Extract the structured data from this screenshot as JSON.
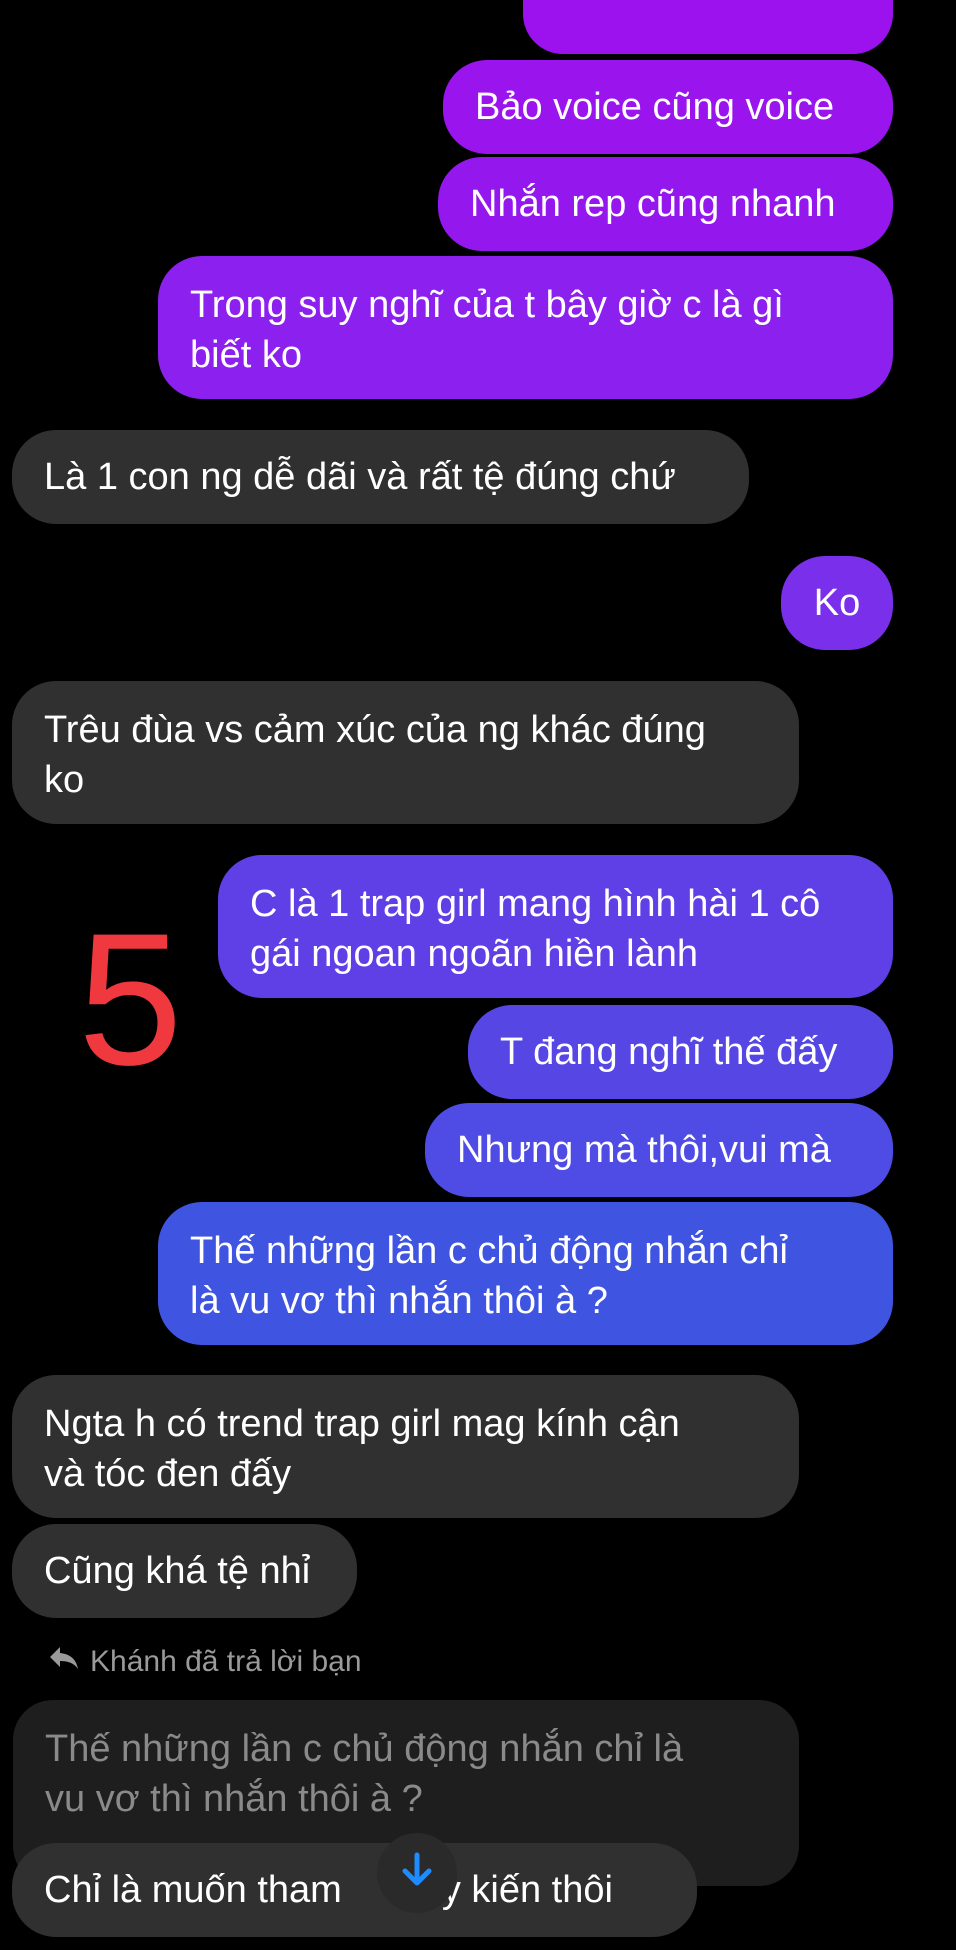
{
  "messages": {
    "m1": "Bảo voice cũng voice",
    "m2": "Nhắn rep cũng nhanh",
    "m3_line1": "Trong suy nghĩ của t bây giờ c là gì",
    "m3_line2": "biết ko",
    "r1": "Là 1 con ng dễ dãi và rất tệ đúng chứ",
    "m4": "Ko",
    "r2_line1": "Trêu đùa vs cảm xúc của ng khác đúng",
    "r2_line2": "ko",
    "m5_line1": "C là 1 trap girl mang hình hài 1 cô",
    "m5_line2": "gái ngoan ngoãn hiền lành",
    "m6": "T đang nghĩ thế đấy",
    "m7": "Nhưng mà thôi,vui mà",
    "m8_line1": "Thế những lần c chủ động nhắn chỉ",
    "m8_line2": "là vu vơ thì nhắn thôi à ?",
    "r3_line1": "Ngta h có trend trap girl mag kính cận",
    "r3_line2": "và tóc đen đấy",
    "r4": "Cũng khá tệ nhỉ",
    "reply_note": "Khánh đã trả lời bạn",
    "quote_line1": "Thế những lần c chủ động nhắn chỉ là",
    "quote_line2": "vu vơ thì nhắn thôi à ?",
    "r5_part1": "Chỉ là muốn tham",
    "r5_part2": "ý kiến thôi"
  },
  "overlay_number": "5",
  "colors": {
    "purple_top": "#9C12EE",
    "purple_mid": "#7F2EEA",
    "indigo": "#5B43E6",
    "blue": "#3E54E2",
    "received_bg": "#303030",
    "overlay_red": "#F0393F"
  },
  "icons": {
    "reply": "reply-arrow-icon",
    "scroll": "arrow-down-icon"
  }
}
